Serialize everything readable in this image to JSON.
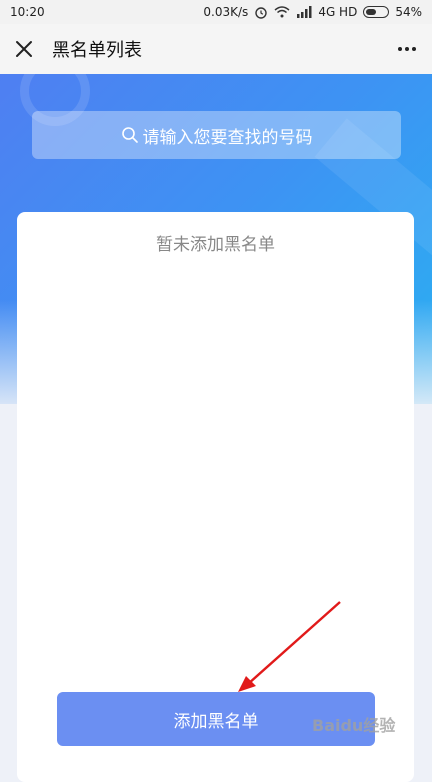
{
  "status_bar": {
    "time": "10:20",
    "network_speed": "0.03K/s",
    "signal": "4G HD",
    "battery": "54%",
    "battery_level": 0.54
  },
  "header": {
    "title": "黑名单列表"
  },
  "search": {
    "placeholder": "请输入您要查找的号码"
  },
  "list": {
    "empty_text": "暂未添加黑名单"
  },
  "actions": {
    "add_label": "添加黑名单"
  },
  "watermark": {
    "text": "Baidu经验"
  },
  "colors": {
    "accent": "#6b8ff2",
    "annotation": "#e11a1a"
  }
}
